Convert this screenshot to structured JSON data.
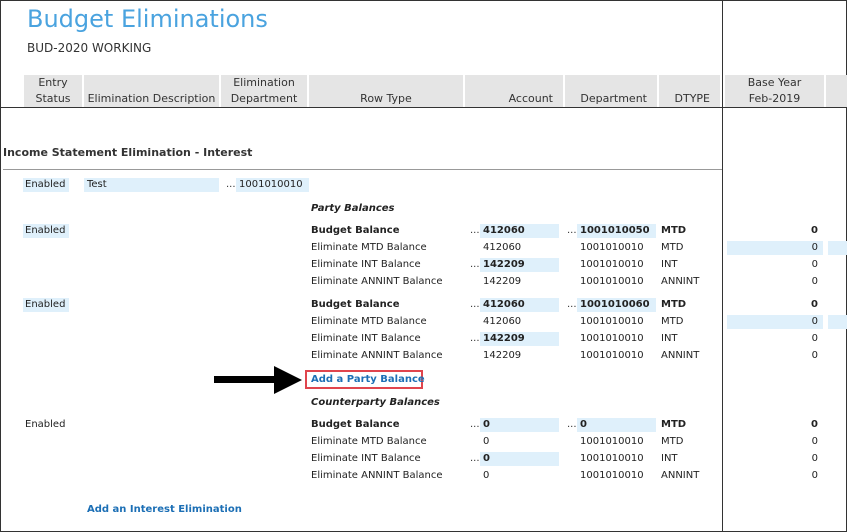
{
  "page": {
    "title": "Budget Eliminations",
    "subtitle": "BUD-2020 WORKING"
  },
  "columns": {
    "entry_status_1": "Entry",
    "entry_status_2": "Status",
    "elim_desc": "Elimination Description",
    "elim_dept_1": "Elimination",
    "elim_dept_2": "Department",
    "row_type": "Row Type",
    "account": "Account",
    "department": "Department",
    "dtype": "DTYPE",
    "base_year_1": "Base Year",
    "base_year_2": "Feb-2019"
  },
  "section": {
    "title": "Income Statement Elimination - Interest"
  },
  "elimination": {
    "status": "Enabled",
    "description": "Test",
    "department": "1001010010",
    "ellipsis": "..."
  },
  "party_balances_label": "Party Balances",
  "counterparty_balances_label": "Counterparty Balances",
  "party_group_1": {
    "status": "Enabled",
    "rows": [
      {
        "row_type": "Budget Balance",
        "account": "412060",
        "department": "1001010050",
        "dtype": "MTD",
        "value": "0"
      },
      {
        "row_type": "Eliminate MTD Balance",
        "account": "412060",
        "department": "1001010010",
        "dtype": "MTD",
        "value": "0"
      },
      {
        "row_type": "Eliminate INT Balance",
        "account": "142209",
        "department": "1001010010",
        "dtype": "INT",
        "value": "0"
      },
      {
        "row_type": "Eliminate ANNINT Balance",
        "account": "142209",
        "department": "1001010010",
        "dtype": "ANNINT",
        "value": "0"
      }
    ]
  },
  "party_group_2": {
    "status": "Enabled",
    "rows": [
      {
        "row_type": "Budget Balance",
        "account": "412060",
        "department": "1001010060",
        "dtype": "MTD",
        "value": "0"
      },
      {
        "row_type": "Eliminate MTD Balance",
        "account": "412060",
        "department": "1001010010",
        "dtype": "MTD",
        "value": "0"
      },
      {
        "row_type": "Eliminate INT Balance",
        "account": "142209",
        "department": "1001010010",
        "dtype": "INT",
        "value": "0"
      },
      {
        "row_type": "Eliminate ANNINT Balance",
        "account": "142209",
        "department": "1001010010",
        "dtype": "ANNINT",
        "value": "0"
      }
    ]
  },
  "counterparty_group": {
    "status": "Enabled",
    "rows": [
      {
        "row_type": "Budget Balance",
        "account": "0",
        "department": "0",
        "dtype": "MTD",
        "value": "0"
      },
      {
        "row_type": "Eliminate MTD Balance",
        "account": "0",
        "department": "1001010010",
        "dtype": "MTD",
        "value": "0"
      },
      {
        "row_type": "Eliminate INT Balance",
        "account": "0",
        "department": "1001010010",
        "dtype": "INT",
        "value": "0"
      },
      {
        "row_type": "Eliminate ANNINT Balance",
        "account": "0",
        "department": "1001010010",
        "dtype": "ANNINT",
        "value": "0"
      }
    ]
  },
  "links": {
    "add_party_balance": "Add a Party Balance",
    "add_interest_elimination": "Add an Interest Elimination"
  },
  "annotation": {
    "arrow_icon": "arrow-right-icon",
    "highlight_color": "#e0454d"
  },
  "colors": {
    "title": "#4aa3df",
    "header_bg": "#e5e5e5",
    "editable_bg": "#dff0fb",
    "link": "#1c6fb5"
  }
}
